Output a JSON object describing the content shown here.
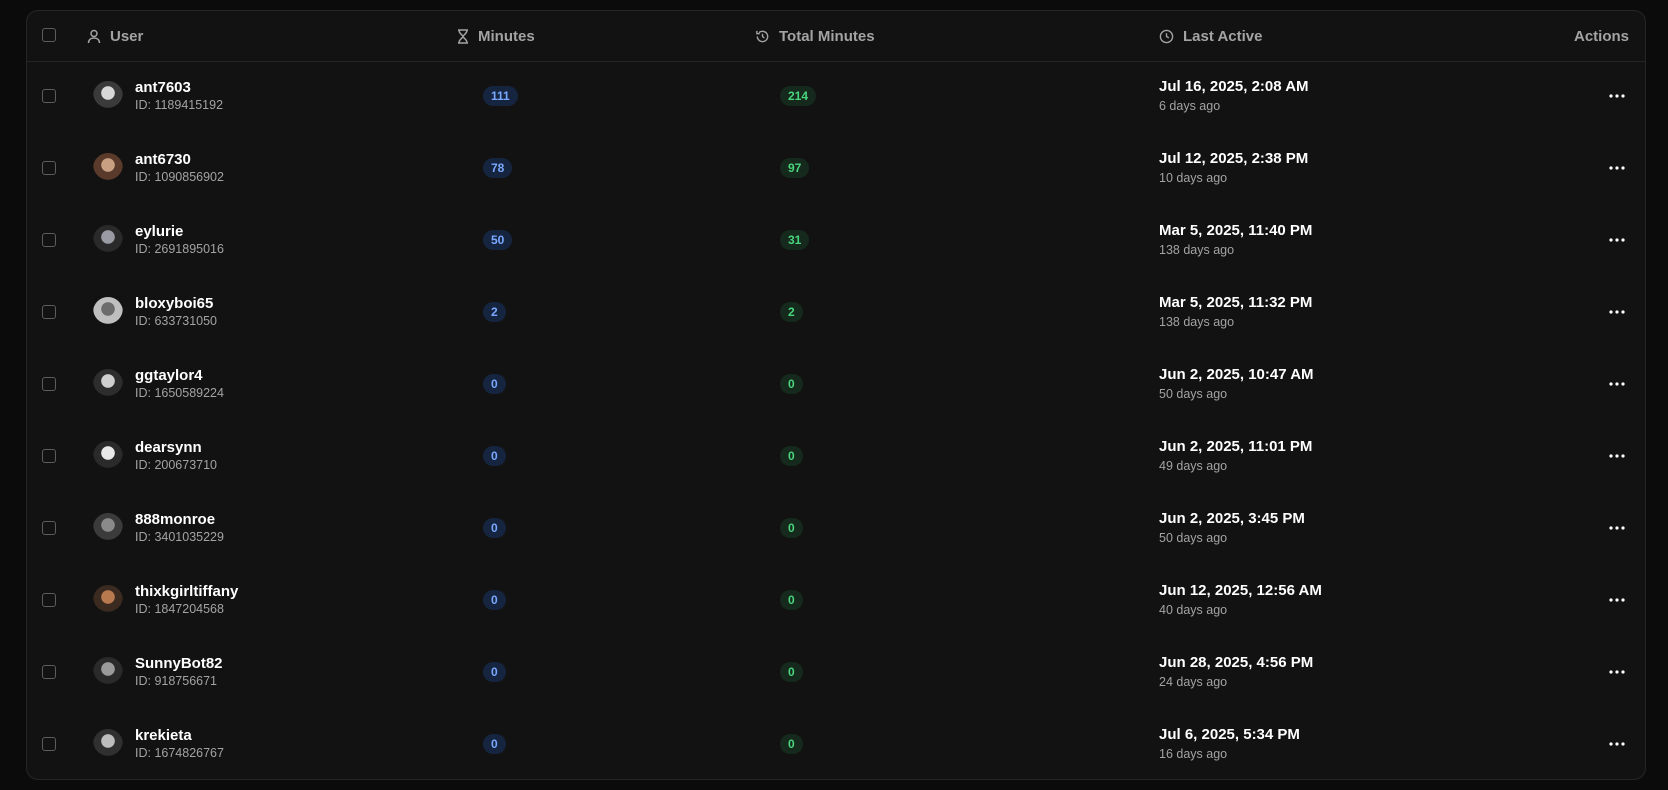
{
  "table": {
    "headers": {
      "user": "User",
      "minutes": "Minutes",
      "total_minutes": "Total Minutes",
      "last_active": "Last Active",
      "actions": "Actions"
    },
    "header_icons": {
      "user": "user-icon",
      "minutes": "hourglass-icon",
      "total_minutes": "history-icon",
      "last_active": "clock-icon"
    },
    "actions_icon": "more-horizontal-icon",
    "rows": [
      {
        "username": "ant7603",
        "id": "ID: 1189415192",
        "minutes": "111",
        "total_minutes": "214",
        "last_active": "Jul 16, 2025, 2:08 AM",
        "ago": "6 days ago"
      },
      {
        "username": "ant6730",
        "id": "ID: 1090856902",
        "minutes": "78",
        "total_minutes": "97",
        "last_active": "Jul 12, 2025, 2:38 PM",
        "ago": "10 days ago"
      },
      {
        "username": "eylurie",
        "id": "ID: 2691895016",
        "minutes": "50",
        "total_minutes": "31",
        "last_active": "Mar 5, 2025, 11:40 PM",
        "ago": "138 days ago"
      },
      {
        "username": "bloxyboi65",
        "id": "ID: 633731050",
        "minutes": "2",
        "total_minutes": "2",
        "last_active": "Mar 5, 2025, 11:32 PM",
        "ago": "138 days ago"
      },
      {
        "username": "ggtaylor4",
        "id": "ID: 1650589224",
        "minutes": "0",
        "total_minutes": "0",
        "last_active": "Jun 2, 2025, 10:47 AM",
        "ago": "50 days ago"
      },
      {
        "username": "dearsynn",
        "id": "ID: 200673710",
        "minutes": "0",
        "total_minutes": "0",
        "last_active": "Jun 2, 2025, 11:01 PM",
        "ago": "49 days ago"
      },
      {
        "username": "888monroe",
        "id": "ID: 3401035229",
        "minutes": "0",
        "total_minutes": "0",
        "last_active": "Jun 2, 2025, 3:45 PM",
        "ago": "50 days ago"
      },
      {
        "username": "thixkgirltiffany",
        "id": "ID: 1847204568",
        "minutes": "0",
        "total_minutes": "0",
        "last_active": "Jun 12, 2025, 12:56 AM",
        "ago": "40 days ago"
      },
      {
        "username": "SunnyBot82",
        "id": "ID: 918756671",
        "minutes": "0",
        "total_minutes": "0",
        "last_active": "Jun 28, 2025, 4:56 PM",
        "ago": "24 days ago"
      },
      {
        "username": "krekieta",
        "id": "ID: 1674826767",
        "minutes": "0",
        "total_minutes": "0",
        "last_active": "Jul 6, 2025, 5:34 PM",
        "ago": "16 days ago"
      }
    ]
  },
  "colors": {
    "background": "#0b0b0b",
    "panel": "#121212",
    "minutes_badge_bg": "#16253f",
    "minutes_badge_text": "#7aa8ff",
    "total_badge_bg": "#15291d",
    "total_badge_text": "#4ad47c"
  }
}
